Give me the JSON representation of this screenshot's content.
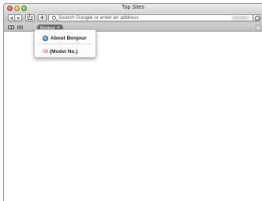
{
  "window": {
    "title": "Top Sites"
  },
  "toolbar": {
    "back_icon": "back-arrow-icon",
    "forward_icon": "forward-arrow-icon",
    "share_icon": "share-icon",
    "add_label": "+",
    "address_placeholder": "Search Google or enter an address",
    "search_icon": "search-icon",
    "reader_label": "Reader"
  },
  "bookmarks_bar": {
    "reading_list_icon": "reading-list-icon",
    "top_sites_icon": "top-sites-grid-icon",
    "bonjour_label": "Bonjour",
    "overflow_label": "»"
  },
  "bonjour_menu": {
    "items": [
      {
        "label": "About Bonjour",
        "icon": "bonjour-icon"
      },
      {
        "label": "(Model No.)",
        "icon": "device-icon"
      }
    ]
  },
  "colors": {
    "traffic_close": "#e0443a",
    "traffic_minimize": "#e8a824",
    "traffic_zoom": "#4faa2c",
    "bonjour_pill": "#6f6f6f"
  }
}
